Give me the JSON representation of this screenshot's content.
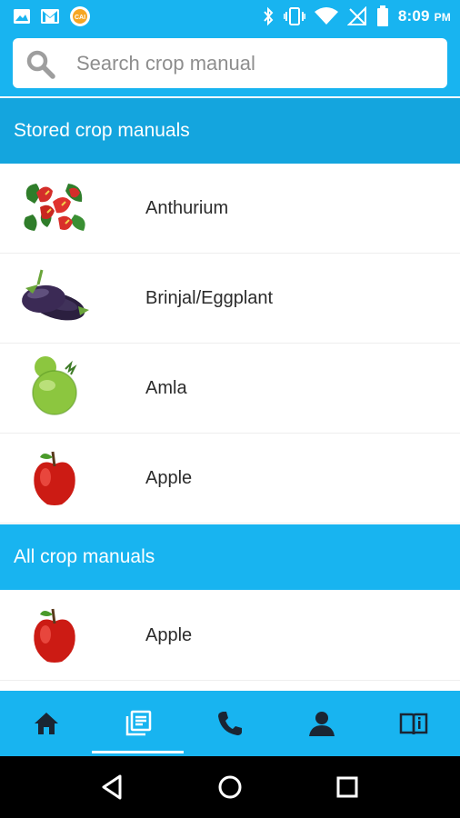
{
  "status_bar": {
    "time": "8:09",
    "ampm": "PM",
    "icons": [
      "image-icon",
      "gmail-icon",
      "app-badge-icon",
      "bluetooth-icon",
      "vibrate-icon",
      "wifi-icon",
      "no-signal-icon",
      "battery-icon"
    ]
  },
  "search": {
    "placeholder": "Search crop manual",
    "value": ""
  },
  "sections": {
    "stored": {
      "title": "Stored crop manuals",
      "items": [
        {
          "name": "Anthurium",
          "icon": "anthurium-image"
        },
        {
          "name": "Brinjal/Eggplant",
          "icon": "eggplant-image"
        },
        {
          "name": "Amla",
          "icon": "amla-image"
        },
        {
          "name": "Apple",
          "icon": "apple-image"
        }
      ]
    },
    "all": {
      "title": "All crop manuals",
      "items": [
        {
          "name": "Apple",
          "icon": "apple-image"
        }
      ]
    }
  },
  "tabbar": {
    "tabs": [
      {
        "name": "home",
        "icon": "home-icon",
        "active": false
      },
      {
        "name": "manuals",
        "icon": "manuals-icon",
        "active": true
      },
      {
        "name": "call",
        "icon": "phone-icon",
        "active": false
      },
      {
        "name": "profile",
        "icon": "person-icon",
        "active": false
      },
      {
        "name": "guide",
        "icon": "book-icon",
        "active": false
      }
    ]
  },
  "colors": {
    "primary": "#18b4f0",
    "section_dark": "#14a5de",
    "text": "#2b2b2b",
    "placeholder": "#8e8e8e"
  }
}
